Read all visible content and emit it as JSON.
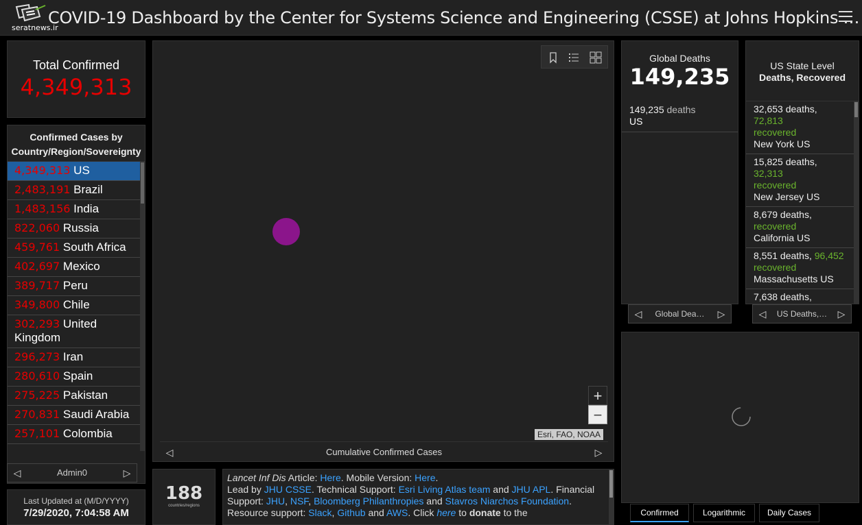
{
  "header": {
    "title": "COVID-19 Dashboard by the Center for Systems Science and Engineering (CSSE) at Johns Hopkins …",
    "watermark": "seratnews.ir"
  },
  "total_confirmed": {
    "label": "Total Confirmed",
    "value": "4,349,313",
    "color": "#e60000"
  },
  "country_panel": {
    "heading": "Confirmed Cases by Country/Region/Sovereignty",
    "items": [
      {
        "count": "4,349,313",
        "name": "US",
        "selected": true
      },
      {
        "count": "2,483,191",
        "name": "Brazil"
      },
      {
        "count": "1,483,156",
        "name": "India"
      },
      {
        "count": "822,060",
        "name": "Russia"
      },
      {
        "count": "459,761",
        "name": "South Africa"
      },
      {
        "count": "402,697",
        "name": "Mexico"
      },
      {
        "count": "389,717",
        "name": "Peru"
      },
      {
        "count": "349,800",
        "name": "Chile"
      },
      {
        "count": "302,293",
        "name": "United Kingdom"
      },
      {
        "count": "296,273",
        "name": "Iran"
      },
      {
        "count": "280,610",
        "name": "Spain"
      },
      {
        "count": "275,225",
        "name": "Pakistan"
      },
      {
        "count": "270,831",
        "name": "Saudi Arabia"
      },
      {
        "count": "257,101",
        "name": "Colombia"
      }
    ],
    "pager_label": "Admin0"
  },
  "last_updated": {
    "label": "Last Updated at (M/D/YYYY)",
    "value": "7/29/2020, 7:04:58 AM"
  },
  "map": {
    "attribution": "Esri, FAO, NOAA",
    "pager_label": "Cumulative Confirmed Cases",
    "dot_color": "#8b158b",
    "zoom_in": "+",
    "zoom_out": "−"
  },
  "countries_count": {
    "value": "188",
    "label": "countries/regions"
  },
  "info": {
    "t1": "Lancet Inf Dis",
    "t2": " Article: ",
    "l_here1": "Here",
    "t3": ". Mobile Version: ",
    "l_here2": "Here",
    "t4": ".",
    "t5": "Lead by ",
    "l_csse": "JHU CSSE",
    "t6": ". Technical Support: ",
    "l_esri": "Esri Living Atlas team",
    "t7": " and ",
    "l_apl": "JHU APL",
    "t8": ". Financial Support: ",
    "l_jhu": "JHU",
    "t9": ", ",
    "l_nsf": "NSF",
    "t10": ", ",
    "l_bloom": "Bloomberg Philanthropies",
    "t11": " and ",
    "l_stavros": "Stavros Niarchos Foundation",
    "t12": ". Resource support: ",
    "l_slack": "Slack",
    "t13": ", ",
    "l_github": "Github",
    "t14": " and ",
    "l_aws": "AWS",
    "t15": ". Click ",
    "l_here3": "here",
    "t16": " to ",
    "t17": "donate",
    "t18": " to the"
  },
  "global_deaths": {
    "label": "Global Deaths",
    "value": "149,235",
    "row_count": "149,235",
    "row_unit": " deaths",
    "row_country": "US",
    "pager_label": "Global Dea…"
  },
  "us_state": {
    "heading_line1": "US State Level",
    "heading_line2": "Deaths, Recovered",
    "rows": [
      {
        "deaths": "32,653",
        "recovered": "72,813",
        "state": "New York US"
      },
      {
        "deaths": "15,825",
        "recovered": "32,313",
        "state": "New Jersey US"
      },
      {
        "deaths": "8,679",
        "recovered": "",
        "state": "California US"
      },
      {
        "deaths": "8,551",
        "recovered": "96,452",
        "state": "Massachusetts US"
      },
      {
        "deaths": "7,638",
        "recovered": "",
        "state": ""
      }
    ],
    "deaths_word": " deaths",
    "recovered_word": "recovered",
    "pager_label": "US Deaths,…"
  },
  "chart_tabs": [
    {
      "label": "Confirmed",
      "active": true
    },
    {
      "label": "Logarithmic"
    },
    {
      "label": "Daily Cases"
    }
  ],
  "colors": {
    "accent_blue": "#3ba2ff",
    "selected_row": "#1f5fa0",
    "recovered_green": "#6ab42d"
  }
}
